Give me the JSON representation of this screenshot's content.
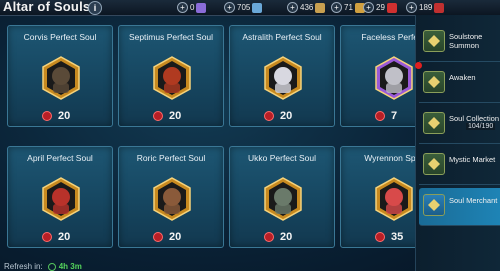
{
  "header": {
    "title": "Altar of Souls",
    "info_label": "i",
    "resources": [
      {
        "name": "gems",
        "value": "0",
        "color": "#8a6cd8"
      },
      {
        "name": "energy",
        "value": "705",
        "color": "#6aa8d8"
      },
      {
        "name": "silver",
        "value": "436",
        "color": "#c8a050"
      },
      {
        "name": "arena-tokens",
        "value": "71",
        "color": "#d0a040"
      },
      {
        "name": "soul-essence",
        "value": "29",
        "color": "#d03030"
      },
      {
        "name": "shards",
        "value": "189",
        "color": "#c03030"
      }
    ]
  },
  "cards": [
    {
      "name": "Corvis Perfect Soul",
      "cost": "20",
      "frame": "#c88a20",
      "portrait": "#5a4a38"
    },
    {
      "name": "Septimus Perfect Soul",
      "cost": "20",
      "frame": "#c88a20",
      "portrait": "#b03a20"
    },
    {
      "name": "Astralith Perfect Soul",
      "cost": "20",
      "frame": "#c88a20",
      "portrait": "#d8d8e0"
    },
    {
      "name": "Faceless Perfect",
      "cost": "7",
      "frame": "#9a5ad8",
      "portrait": "#c0c0c8"
    },
    {
      "name": "April Perfect Soul",
      "cost": "20",
      "frame": "#c88a20",
      "portrait": "#b8322a"
    },
    {
      "name": "Roric Perfect Soul",
      "cost": "20",
      "frame": "#c88a20",
      "portrait": "#8a5a3a"
    },
    {
      "name": "Ukko Perfect Soul",
      "cost": "20",
      "frame": "#c88a20",
      "portrait": "#6a7a6a"
    },
    {
      "name": "Wyrennon Split",
      "cost": "35",
      "frame": "#c88a20",
      "portrait": "#d84a4a"
    }
  ],
  "menu": [
    {
      "label": "Soulstone Summon",
      "icon": "soulstone-icon",
      "active": false,
      "badge": false
    },
    {
      "label": "Awaken",
      "icon": "awaken-icon",
      "active": false,
      "badge": true
    },
    {
      "label": "Soul Collection",
      "icon": "soul-collection-icon",
      "active": false,
      "badge": false
    },
    {
      "label": "Mystic Market",
      "icon": "mystic-market-icon",
      "active": false,
      "badge": false
    },
    {
      "label": "Soul Merchant",
      "icon": "soul-merchant-icon",
      "active": true,
      "badge": false
    }
  ],
  "collection_counter": "104/190",
  "refresh": {
    "label": "Refresh in:",
    "time": "4h 3m"
  }
}
